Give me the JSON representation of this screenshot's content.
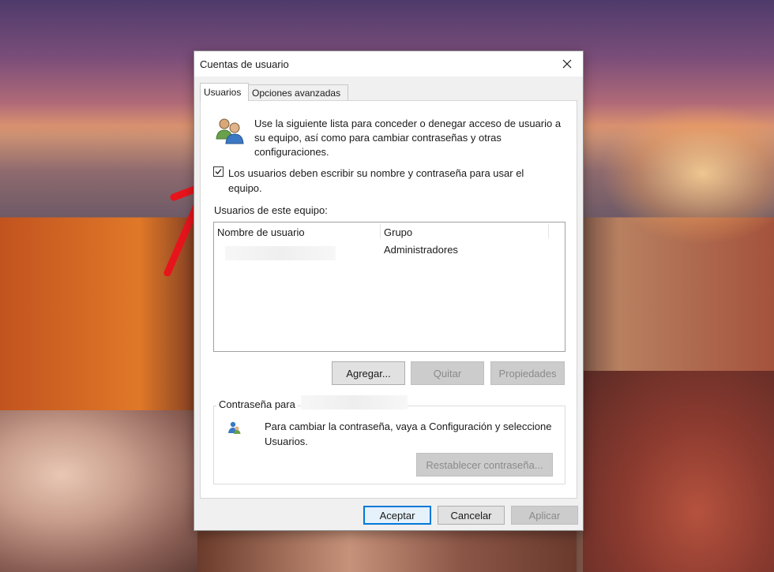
{
  "dialog": {
    "title": "Cuentas de usuario",
    "tabs": [
      {
        "label": "Usuarios",
        "active": true
      },
      {
        "label": "Opciones avanzadas",
        "active": false
      }
    ],
    "intro_text": "Use la siguiente lista para conceder o denegar acceso de usuario a su equipo, así como para cambiar contraseñas y otras configuraciones.",
    "checkbox": {
      "label": "Los usuarios deben escribir su nombre y contraseña para usar el equipo.",
      "checked": true
    },
    "users_section_label": "Usuarios de este equipo:",
    "users_table": {
      "columns": [
        "Nombre de usuario",
        "Grupo"
      ],
      "rows": [
        {
          "name": "",
          "group": "Administradores"
        }
      ]
    },
    "buttons": {
      "add": "Agregar...",
      "remove": "Quitar",
      "properties": "Propiedades"
    },
    "password_group": {
      "title": "Contraseña para",
      "text": "Para cambiar la contraseña, vaya a Configuración y seleccione Usuarios.",
      "reset_button": "Restablecer contraseña..."
    },
    "footer": {
      "ok": "Aceptar",
      "cancel": "Cancelar",
      "apply": "Aplicar"
    }
  },
  "colors": {
    "accent": "#0078d7",
    "annotation_arrow": "#e8141c"
  },
  "icons": [
    "users-icon",
    "close-icon",
    "checkmark-icon",
    "user-small-icon",
    "annotation-arrow-icon"
  ]
}
